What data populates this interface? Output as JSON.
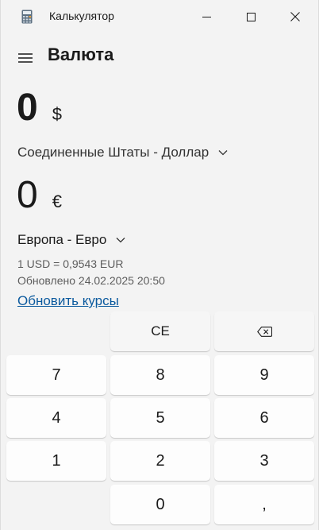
{
  "window": {
    "title": "Калькулятор",
    "icon": "calculator-icon"
  },
  "header": {
    "mode_title": "Валюта",
    "menu_icon": "hamburger-icon"
  },
  "from": {
    "amount": "0",
    "symbol": "$",
    "currency": "Соединенные Штаты - Доллар"
  },
  "to": {
    "amount": "0",
    "symbol": "€",
    "currency": "Европа - Евро"
  },
  "rate": {
    "line1": "1 USD = 0,9543 EUR",
    "line2": "Обновлено 24.02.2025 20:50",
    "update_link": "Обновить курсы"
  },
  "keypad": {
    "ce": "CE",
    "backspace_icon": "backspace-icon",
    "digits": [
      "7",
      "8",
      "9",
      "4",
      "5",
      "6",
      "1",
      "2",
      "3",
      "0"
    ],
    "decimal": ","
  },
  "colors": {
    "background": "#f3f3f3",
    "key": "#fdfdfd",
    "link": "#0b5a9e"
  }
}
